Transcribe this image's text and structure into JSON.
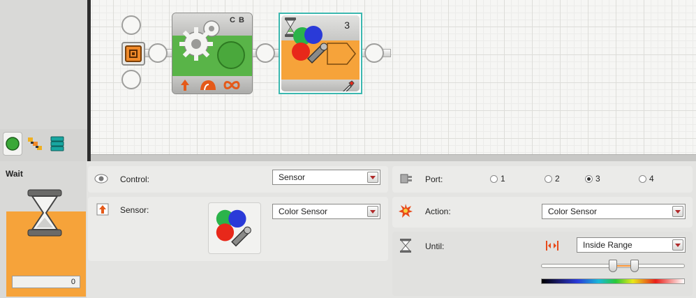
{
  "palette": {
    "tabs": [
      {
        "icon": "common-palette-icon",
        "active": true
      },
      {
        "icon": "complete-palette-icon",
        "active": false
      },
      {
        "icon": "custom-palette-icon",
        "active": false
      }
    ]
  },
  "program": {
    "motor_block": {
      "ports": "C B",
      "icons": [
        "direction-up-icon",
        "power-icon",
        "duration-unlimited-icon"
      ]
    },
    "wait_block": {
      "port": "3",
      "icons": [
        "hourglass-icon",
        "color-sensor-icon",
        "dropper-icon"
      ]
    }
  },
  "config": {
    "block_name": "Wait",
    "counter_value": "0",
    "control": {
      "label": "Control:",
      "value": "Sensor"
    },
    "sensor": {
      "label": "Sensor:",
      "value": "Color Sensor"
    },
    "port": {
      "label": "Port:",
      "options": [
        {
          "label": "1",
          "selected": false
        },
        {
          "label": "2",
          "selected": false
        },
        {
          "label": "3",
          "selected": true
        },
        {
          "label": "4",
          "selected": false
        }
      ]
    },
    "action": {
      "label": "Action:",
      "value": "Color Sensor"
    },
    "until": {
      "label": "Until:",
      "value": "Inside Range",
      "range_low_fraction": 0.5,
      "range_high_fraction": 0.65
    }
  },
  "colors": {
    "accent_orange": "#f6a33a",
    "motor_green": "#59b448",
    "selection_teal": "#3cb8b0"
  }
}
